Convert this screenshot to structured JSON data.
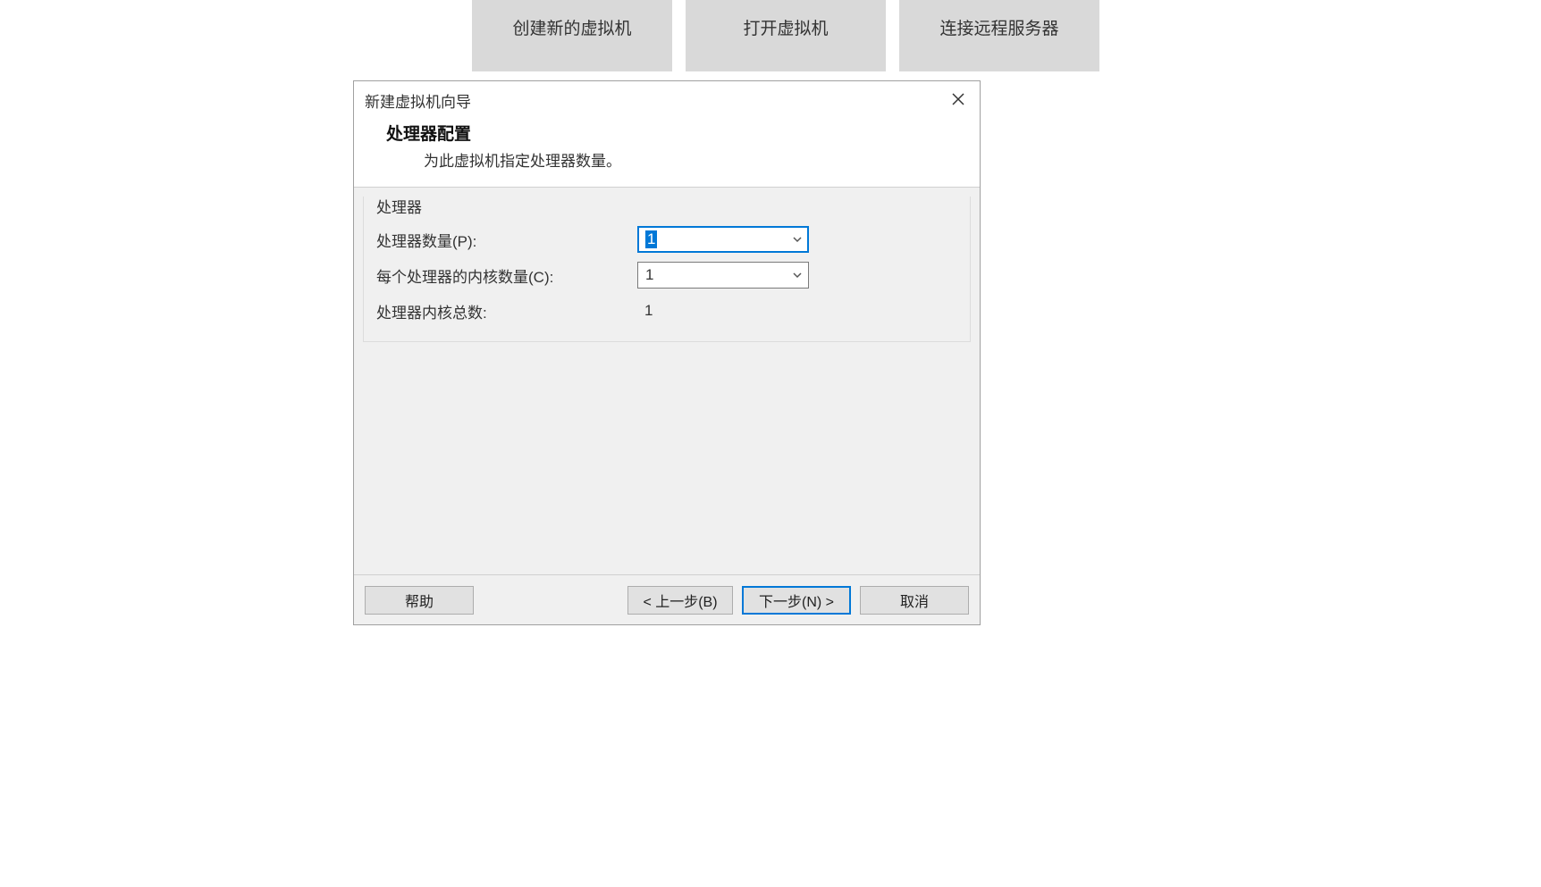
{
  "topButtons": {
    "create": "创建新的虚拟机",
    "open": "打开虚拟机",
    "connect": "连接远程服务器"
  },
  "dialog": {
    "title": "新建虚拟机向导",
    "headerTitle": "处理器配置",
    "headerSub": "为此虚拟机指定处理器数量。",
    "groupLabel": "处理器",
    "rows": {
      "processorsLabel": "处理器数量(P):",
      "processorsValue": "1",
      "coresLabel": "每个处理器的内核数量(C):",
      "coresValue": "1",
      "totalLabel": "处理器内核总数:",
      "totalValue": "1"
    },
    "footer": {
      "help": "帮助",
      "back": "< 上一步(B)",
      "next": "下一步(N) >",
      "cancel": "取消"
    }
  }
}
